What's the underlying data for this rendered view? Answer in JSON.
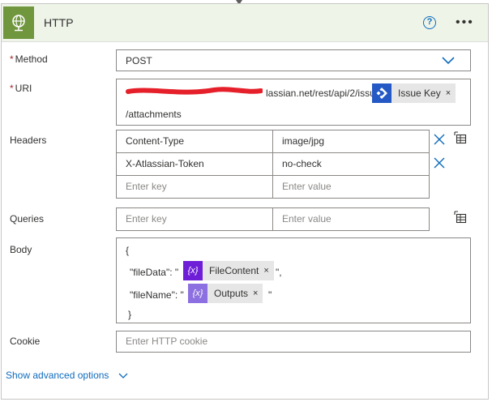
{
  "action": {
    "title": "HTTP",
    "help_icon": "?",
    "more_icon": "•••"
  },
  "colors": {
    "header_bg": "#eef4e8",
    "http_icon_bg": "#70963e",
    "jira_icon_bg": "#2358c5",
    "expression_icon_bg": "#6f1ed8",
    "variable_icon_bg": "#8c6fe0",
    "redaction": "#e5202a",
    "link": "#0f6cbd"
  },
  "fields": {
    "method": {
      "required_mark": "*",
      "label": "Method",
      "value": "POST"
    },
    "uri": {
      "required_mark": "*",
      "label": "URI",
      "text_visible": "lassian.net/rest/api/2/issue/",
      "token_label": "Issue Key",
      "token_close": "×",
      "line2": "/attachments"
    },
    "headers": {
      "label": "Headers",
      "rows": [
        {
          "key": "Content-Type",
          "value": "image/jpg"
        },
        {
          "key": "X-Atlassian-Token",
          "value": "no-check"
        }
      ],
      "key_placeholder": "Enter key",
      "value_placeholder": "Enter value"
    },
    "queries": {
      "label": "Queries",
      "key_placeholder": "Enter key",
      "value_placeholder": "Enter value"
    },
    "body": {
      "label": "Body",
      "open": "{",
      "line1_prefix": "\"fileData\": \"",
      "line1_token": "FileContent",
      "line1_suffix": "\",",
      "line2_prefix": "\"fileName\": \"",
      "line2_token": "Outputs",
      "line2_suffix": "\"",
      "close": "}",
      "token_close": "×",
      "expression_icon_text": "{x}",
      "variable_icon_text": "{x}"
    },
    "cookie": {
      "label": "Cookie",
      "placeholder": "Enter HTTP cookie"
    }
  },
  "advanced": {
    "label": "Show advanced options"
  }
}
